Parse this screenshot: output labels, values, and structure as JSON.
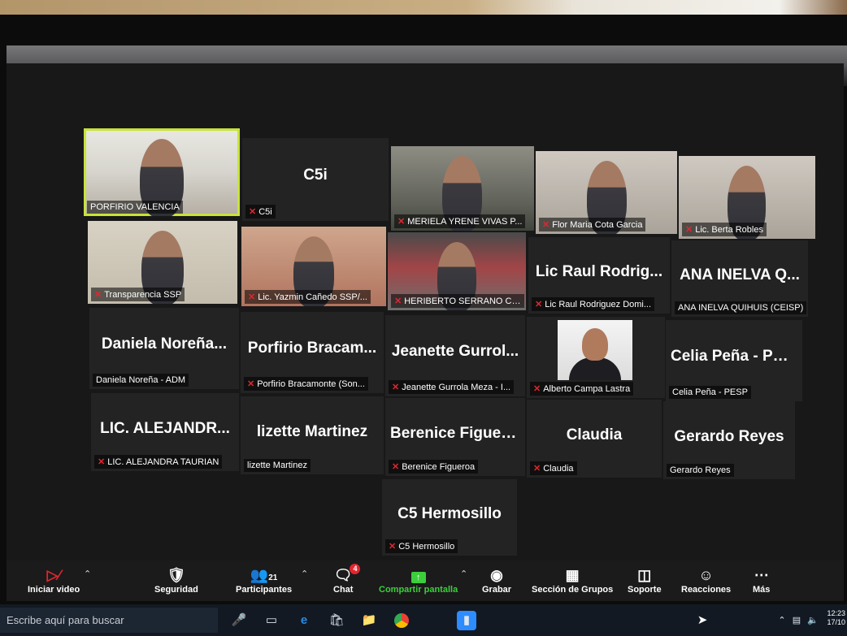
{
  "tiles": [
    {
      "id": "porfirio-valencia",
      "label": "PORFIRIO VALENCIA",
      "muted": false,
      "video": true,
      "bg": "v-room",
      "active": true
    },
    {
      "id": "c5i",
      "big": "C5i",
      "label": "C5i",
      "muted": true
    },
    {
      "id": "meriela",
      "label": "MERIELA YRENE VIVAS P...",
      "muted": true,
      "video": true,
      "bg": "v-grey"
    },
    {
      "id": "flor",
      "label": "Flor Maria Cota Garcia",
      "muted": true,
      "video": true,
      "bg": "v-light"
    },
    {
      "id": "berta",
      "label": "Lic. Berta Robles",
      "muted": true,
      "video": true,
      "bg": "v-light"
    },
    {
      "id": "transparencia",
      "label": "Transparencia SSP",
      "muted": true,
      "video": true,
      "bg": "v-office"
    },
    {
      "id": "yazmin",
      "label": "Lic. Yazmin Cañedo SSP/...",
      "muted": true,
      "video": true,
      "bg": "v-warm"
    },
    {
      "id": "heriberto",
      "label": "HERIBERTO SERRANO CEI...",
      "muted": true,
      "video": true,
      "bg": "v-red"
    },
    {
      "id": "raul",
      "big": "Lic Raul Rodrig...",
      "label": "Lic Raul Rodriguez Domi...",
      "muted": true
    },
    {
      "id": "ana",
      "big": "ANA INELVA Q...",
      "label": "ANA INELVA QUIHUIS (CEISP)",
      "muted": false
    },
    {
      "id": "daniela",
      "big": "Daniela Noreña...",
      "label": "Daniela Noreña - ADM",
      "muted": false
    },
    {
      "id": "porfirio-b",
      "big": "Porfirio Bracam...",
      "label": "Porfirio Bracamonte (Son...",
      "muted": true
    },
    {
      "id": "jeanette",
      "big": "Jeanette Gurrol...",
      "label": "Jeanette Gurrola Meza - I...",
      "muted": true
    },
    {
      "id": "alberto",
      "label": "Alberto Campa Lastra",
      "muted": true,
      "video": true,
      "bg": "v-photo"
    },
    {
      "id": "celia",
      "big": "Celia Peña - PESP",
      "label": "Celia Peña - PESP",
      "muted": false
    },
    {
      "id": "alejandra",
      "big": "LIC. ALEJANDR...",
      "label": "LIC. ALEJANDRA TAURIAN",
      "muted": true
    },
    {
      "id": "lizette",
      "big": "lizette Martinez",
      "label": "lizette Martinez",
      "muted": false
    },
    {
      "id": "berenice",
      "big": "Berenice Figueroa",
      "label": "Berenice Figueroa",
      "muted": true
    },
    {
      "id": "claudia",
      "big": "Claudia",
      "label": "Claudia",
      "muted": true
    },
    {
      "id": "gerardo",
      "big": "Gerardo Reyes",
      "label": "Gerardo Reyes",
      "muted": false
    },
    {
      "id": "c5h",
      "big": "C5 Hermosillo",
      "label": "C5 Hermosillo",
      "muted": true
    }
  ],
  "toolbar": {
    "start_video": "Iniciar video",
    "security": "Seguridad",
    "participants": "Participantes",
    "participants_count": "21",
    "chat": "Chat",
    "chat_badge": "4",
    "share": "Compartir pantalla",
    "record": "Grabar",
    "breakout": "Sección de Grupos",
    "support": "Soporte",
    "reactions": "Reacciones",
    "more": "Más"
  },
  "taskbar": {
    "search_placeholder": "Escribe aquí para buscar",
    "time": "12:23",
    "date": "17/10"
  },
  "colors": {
    "active_speaker": "#c8e33a",
    "muted_icon": "#e3262f",
    "share_green": "#3ccf3c"
  }
}
